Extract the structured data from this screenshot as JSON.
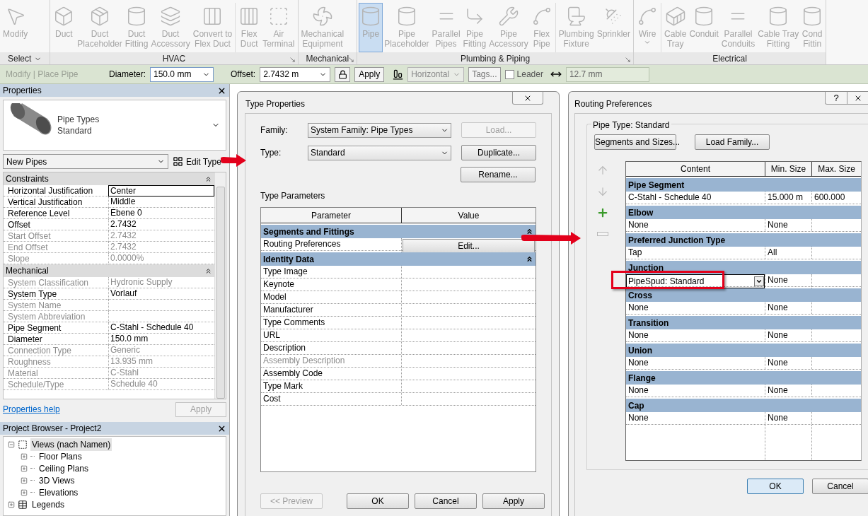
{
  "ribbon": {
    "panels": [
      {
        "label": "Select",
        "dropdown": true,
        "launcher": false,
        "tool_groups": [
          [
            {
              "lines": [
                "Modify"
              ],
              "selected": false,
              "menu": false
            }
          ]
        ]
      },
      {
        "label": "HVAC",
        "dropdown": false,
        "launcher": true,
        "tool_groups": [
          [
            {
              "lines": [
                "Duct"
              ],
              "selected": false,
              "menu": false
            },
            {
              "lines": [
                "Duct",
                "Placeholder"
              ],
              "selected": false,
              "menu": false
            },
            {
              "lines": [
                "Duct",
                "Fitting"
              ],
              "selected": false,
              "menu": false
            },
            {
              "lines": [
                "Duct",
                "Accessory"
              ],
              "selected": false,
              "menu": false
            },
            {
              "lines": [
                "Convert to",
                "Flex Duct"
              ],
              "selected": false,
              "menu": false
            }
          ],
          [
            {
              "lines": [
                "Flex",
                "Duct"
              ],
              "selected": false,
              "menu": false
            },
            {
              "lines": [
                "Air",
                "Terminal"
              ],
              "selected": false,
              "menu": false
            }
          ]
        ]
      },
      {
        "label": "Mechanical",
        "dropdown": false,
        "launcher": true,
        "tool_groups": [
          [
            {
              "lines": [
                "Mechanical",
                "Equipment"
              ],
              "selected": false,
              "menu": false
            }
          ]
        ]
      },
      {
        "label": "Plumbing & Piping",
        "dropdown": false,
        "launcher": true,
        "tool_groups": [
          [
            {
              "lines": [
                "Pipe"
              ],
              "selected": true,
              "menu": false
            },
            {
              "lines": [
                "Pipe",
                "Placeholder"
              ],
              "selected": false,
              "menu": false
            },
            {
              "lines": [
                "Parallel",
                "Pipes"
              ],
              "selected": false,
              "menu": false
            },
            {
              "lines": [
                "Pipe",
                "Fitting"
              ],
              "selected": false,
              "menu": false
            },
            {
              "lines": [
                "Pipe",
                "Accessory"
              ],
              "selected": false,
              "menu": false
            },
            {
              "lines": [
                "Flex",
                "Pipe"
              ],
              "selected": false,
              "menu": false
            }
          ],
          [
            {
              "lines": [
                "Plumbing",
                "Fixture"
              ],
              "selected": false,
              "menu": false
            },
            {
              "lines": [
                "Sprinkler"
              ],
              "selected": false,
              "menu": false
            }
          ]
        ]
      },
      {
        "label": "Electrical",
        "dropdown": false,
        "launcher": false,
        "tool_groups": [
          [
            {
              "lines": [
                "Wire"
              ],
              "selected": false,
              "menu": true
            }
          ],
          [
            {
              "lines": [
                "Cable",
                "Tray"
              ],
              "selected": false,
              "menu": false
            },
            {
              "lines": [
                "Conduit"
              ],
              "selected": false,
              "menu": false
            },
            {
              "lines": [
                "Parallel",
                "Conduits"
              ],
              "selected": false,
              "menu": false
            },
            {
              "lines": [
                "Cable Tray",
                "Fitting"
              ],
              "selected": false,
              "menu": false
            },
            {
              "lines": [
                "Cond",
                "Fittin"
              ],
              "selected": false,
              "menu": false
            }
          ]
        ]
      }
    ]
  },
  "options_bar": {
    "context": "Modify | Place Pipe",
    "diameter": {
      "label": "Diameter:",
      "value": "150.0 mm"
    },
    "offset": {
      "label": "Offset:",
      "value": "2.7432 m"
    },
    "apply": "Apply",
    "justification": {
      "value": "Horizontal",
      "disabled": true
    },
    "tags": "Tags...",
    "leader": {
      "label": "Leader",
      "checked": false
    },
    "length": "12.7 mm"
  },
  "properties": {
    "title": "Properties",
    "type_name": [
      "Pipe Types",
      "Standard"
    ],
    "instance_filter": "New Pipes",
    "edit_type": "Edit Type",
    "groups": [
      {
        "name": "Constraints",
        "expanded": true,
        "rows": [
          {
            "label": "Horizontal Justification",
            "value": "Center",
            "disabled": false,
            "active": true
          },
          {
            "label": "Vertical Justification",
            "value": "Middle",
            "disabled": false,
            "active": false
          },
          {
            "label": "Reference Level",
            "value": "Ebene 0",
            "disabled": false,
            "active": false
          },
          {
            "label": "Offset",
            "value": "2.7432",
            "disabled": false,
            "active": false
          },
          {
            "label": "Start Offset",
            "value": "2.7432",
            "disabled": true,
            "active": false
          },
          {
            "label": "End Offset",
            "value": "2.7432",
            "disabled": true,
            "active": false
          },
          {
            "label": "Slope",
            "value": "0.0000%",
            "disabled": true,
            "active": false
          }
        ]
      },
      {
        "name": "Mechanical",
        "expanded": true,
        "rows": [
          {
            "label": "System Classification",
            "value": "Hydronic Supply",
            "disabled": true,
            "active": false
          },
          {
            "label": "System Type",
            "value": "Vorlauf",
            "disabled": false,
            "active": false
          },
          {
            "label": "System Name",
            "disabled": true,
            "active": false
          },
          {
            "label": "System Abbreviation",
            "disabled": true,
            "active": false
          },
          {
            "label": "Pipe Segment",
            "value": "C-Stahl - Schedule 40",
            "disabled": false,
            "active": false
          },
          {
            "label": "Diameter",
            "value": "150.0 mm",
            "disabled": false,
            "active": false
          },
          {
            "label": "Connection Type",
            "value": "Generic",
            "disabled": true,
            "active": false
          },
          {
            "label": "Roughness",
            "value": "13.935 mm",
            "disabled": true,
            "active": false
          },
          {
            "label": "Material",
            "value": "C-Stahl",
            "disabled": true,
            "active": false
          },
          {
            "label": "Schedule/Type",
            "value": "Schedule 40",
            "disabled": true,
            "active": false
          }
        ]
      }
    ],
    "help": "Properties help",
    "apply": {
      "label": "Apply",
      "disabled": true
    }
  },
  "project_browser": {
    "title": "Project Browser - Project2",
    "tree": [
      {
        "label": "Views (nach Namen)",
        "expanded": true,
        "selected": true,
        "children": [
          {
            "label": "Floor Plans",
            "expanded": false,
            "selected": false
          },
          {
            "label": "Ceiling Plans",
            "expanded": false,
            "selected": false
          },
          {
            "label": "3D Views",
            "expanded": false,
            "selected": false
          },
          {
            "label": "Elevations",
            "expanded": false,
            "selected": false
          }
        ]
      },
      {
        "label": "Legends",
        "expanded": false,
        "selected": false
      }
    ]
  },
  "type_properties": {
    "title": "Type Properties",
    "family": {
      "label": "Family:",
      "value": "System Family: Pipe Types"
    },
    "type": {
      "label": "Type:",
      "value": "Standard"
    },
    "side_buttons": [
      {
        "label": "Load...",
        "disabled": true
      },
      {
        "label": "Duplicate...",
        "disabled": false
      },
      {
        "label": "Rename...",
        "disabled": false
      }
    ],
    "section": "Type Parameters",
    "columns": [
      "Parameter",
      "Value"
    ],
    "groups": [
      {
        "name": "Segments and Fittings",
        "expanded": true,
        "rows": [
          {
            "label": "Routing Preferences",
            "kind": "button",
            "value": "Edit...",
            "disabled": false
          }
        ]
      },
      {
        "name": "Identity Data",
        "expanded": true,
        "rows": [
          {
            "label": "Type Image",
            "kind": "text",
            "disabled": false
          },
          {
            "label": "Keynote",
            "kind": "text",
            "disabled": false
          },
          {
            "label": "Model",
            "kind": "text",
            "disabled": false
          },
          {
            "label": "Manufacturer",
            "kind": "text",
            "disabled": false
          },
          {
            "label": "Type Comments",
            "kind": "text",
            "disabled": false
          },
          {
            "label": "URL",
            "kind": "text",
            "disabled": false
          },
          {
            "label": "Description",
            "kind": "text",
            "disabled": false
          },
          {
            "label": "Assembly Description",
            "kind": "text",
            "disabled": true
          },
          {
            "label": "Assembly Code",
            "kind": "text",
            "disabled": false
          },
          {
            "label": "Type Mark",
            "kind": "text",
            "disabled": false
          },
          {
            "label": "Cost",
            "kind": "text",
            "disabled": false
          }
        ]
      }
    ],
    "footer": [
      {
        "label": "<< Preview",
        "disabled": true
      },
      {
        "label": "OK",
        "disabled": false
      },
      {
        "label": "Cancel",
        "disabled": false
      },
      {
        "label": "Apply",
        "disabled": false
      }
    ]
  },
  "routing_preferences": {
    "title": "Routing Preferences",
    "help": "?",
    "pipe_type": "Pipe Type: Standard",
    "buttons": [
      "Segments and Sizes...",
      "Load Family..."
    ],
    "row_tools": [
      {
        "disabled": true
      },
      {
        "disabled": true
      },
      {
        "disabled": false
      },
      {
        "disabled": true
      }
    ],
    "columns": [
      "Content",
      "Min. Size",
      "Max. Size"
    ],
    "groups": [
      {
        "name": "Pipe Segment",
        "rows": [
          {
            "kind": "text",
            "cells": [
              "C-Stahl - Schedule 40",
              "15.000 m",
              "600.000"
            ],
            "highlighted": false
          }
        ]
      },
      {
        "name": "Elbow",
        "rows": [
          {
            "kind": "text",
            "cells": [
              "None",
              "None"
            ],
            "highlighted": false
          }
        ]
      },
      {
        "name": "Preferred Junction Type",
        "rows": [
          {
            "kind": "text",
            "cells": [
              "Tap",
              "All"
            ],
            "highlighted": false
          }
        ]
      },
      {
        "name": "Junction",
        "rows": [
          {
            "kind": "dropdown",
            "cells": [
              "PipeSpud: Standard",
              "None"
            ],
            "highlighted": true
          }
        ]
      },
      {
        "name": "Cross",
        "rows": [
          {
            "kind": "text",
            "cells": [
              "None",
              "None"
            ],
            "highlighted": false
          }
        ]
      },
      {
        "name": "Transition",
        "rows": [
          {
            "kind": "text",
            "cells": [
              "None",
              "None"
            ],
            "highlighted": false
          }
        ]
      },
      {
        "name": "Union",
        "rows": [
          {
            "kind": "text",
            "cells": [
              "None",
              "None"
            ],
            "highlighted": false
          }
        ]
      },
      {
        "name": "Flange",
        "rows": [
          {
            "kind": "text",
            "cells": [
              "None",
              "None"
            ],
            "highlighted": false
          }
        ]
      },
      {
        "name": "Cap",
        "rows": [
          {
            "kind": "text",
            "cells": [
              "None",
              "None"
            ],
            "highlighted": false
          }
        ]
      }
    ],
    "footer": [
      {
        "label": "OK",
        "default": true
      },
      {
        "label": "Cancel",
        "default": false
      }
    ]
  }
}
